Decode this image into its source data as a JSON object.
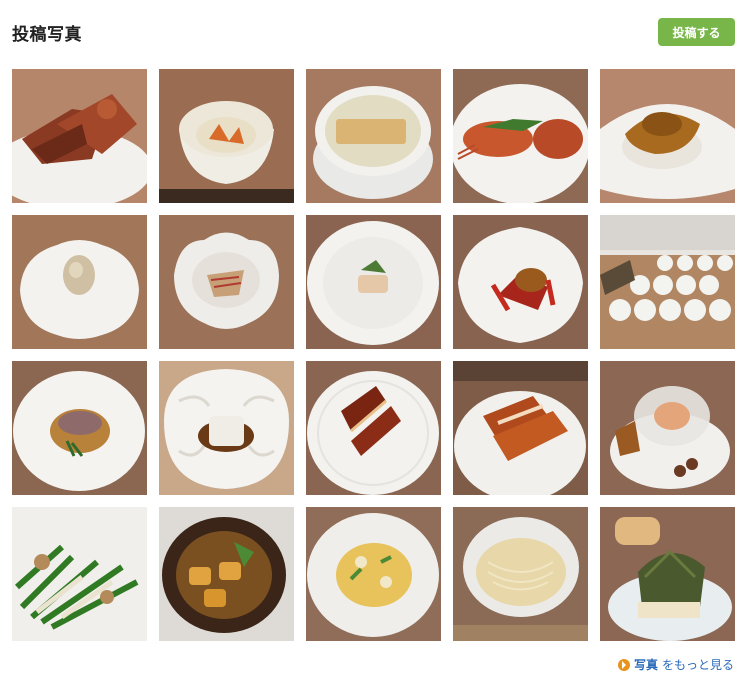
{
  "header": {
    "title": "投稿写真",
    "post_button_label": "投稿する"
  },
  "photos": [
    {
      "subject": "roast-duck-pieces"
    },
    {
      "subject": "crab-roe-in-bowl"
    },
    {
      "subject": "fish-maw-in-broth"
    },
    {
      "subject": "lobster-with-herbs"
    },
    {
      "subject": "braised-dish-over-rice"
    },
    {
      "subject": "crispy-ball-on-plate"
    },
    {
      "subject": "shredded-dish-flower-bowl"
    },
    {
      "subject": "small-appetizer-plate"
    },
    {
      "subject": "chili-stir-fry"
    },
    {
      "subject": "table-of-ingredients"
    },
    {
      "subject": "sliced-meat-in-sauce"
    },
    {
      "subject": "braised-square-patterned-plate"
    },
    {
      "subject": "roast-goose-slices"
    },
    {
      "subject": "roast-chicken-slices"
    },
    {
      "subject": "glass-bowl-with-dessert"
    },
    {
      "subject": "green-vegetable-stir-fry"
    },
    {
      "subject": "clay-pot-stew"
    },
    {
      "subject": "scrambled-egg-dish"
    },
    {
      "subject": "noodle-soup"
    },
    {
      "subject": "steamer-and-leaf-bowl"
    }
  ],
  "footer": {
    "more_bold": "写真",
    "more_rest": "をもっと見る"
  },
  "colors": {
    "accent_green": "#79b64a",
    "link_blue": "#2a6ab8",
    "arrow_orange": "#e8941a"
  }
}
